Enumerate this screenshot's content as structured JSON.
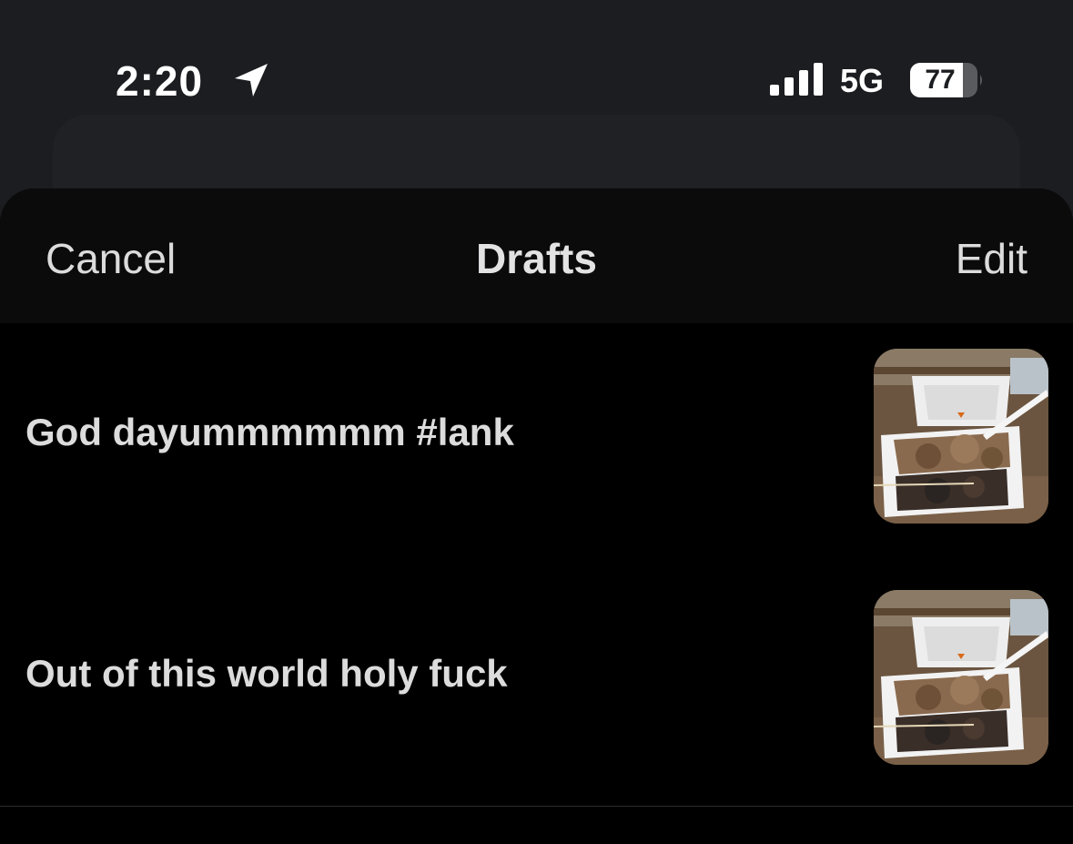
{
  "status_bar": {
    "time": "2:20",
    "network": "5G",
    "battery": "77",
    "icons": [
      "location-arrow-icon",
      "cellular-signal-icon",
      "battery-icon"
    ]
  },
  "nav": {
    "cancel_label": "Cancel",
    "title": "Drafts",
    "edit_label": "Edit"
  },
  "drafts": [
    {
      "text": "God dayummmmmm #lank",
      "thumbnail": "food-container-photo"
    },
    {
      "text": "Out of this world holy fuck",
      "thumbnail": "food-container-photo"
    }
  ],
  "colors": {
    "background": "#1c1d21",
    "sheet": "#000000",
    "nav_bar": "#0b0b0c",
    "text": "#dcdcdd",
    "divider": "#2c2c2e"
  }
}
